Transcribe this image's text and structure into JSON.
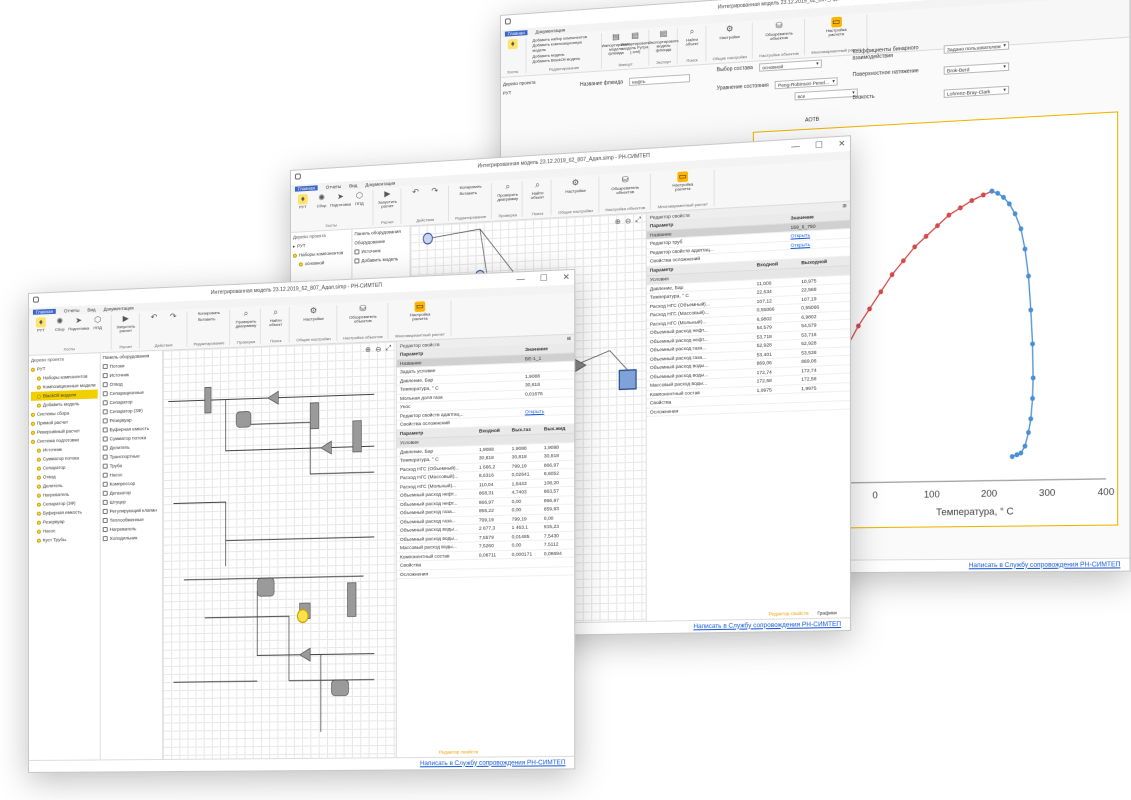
{
  "colors": {
    "accent": "#3a66c4",
    "selection": "#f2d000",
    "link": "#1a5bd6",
    "chart_border": "#f0b400",
    "bubble_curve": "#d34a4a",
    "dew_curve": "#4a8fd6"
  },
  "app": {
    "window_controls": [
      "—",
      "☐",
      "✕"
    ],
    "support_link": "Написать в Службу сопровождения РН-СИМТЕП"
  },
  "win3": {
    "title": "Интегрированная модель 23.12.2019_62_807_Адап.simp - РН-СИМТЕП",
    "tabs": [
      "Главная",
      "Документация"
    ],
    "ribbon": {
      "groups": [
        "Хосты",
        "Редактирование",
        "Импорт",
        "Экспорт",
        "Поиск",
        "Общие настройки",
        "Настройка объектов",
        "Многовариантный расчет"
      ],
      "buttons": [
        "Импортировать модель флюида",
        "Импортировать модель Рутра (.xml)",
        "Экспортировать модель флюида",
        "Найти объект",
        "Настройки",
        "Обозреватель объектов",
        "Настройка расчета"
      ],
      "checks": [
        "Добавить набор компонентов",
        "Добавить композиционную модель",
        "Добавить модель",
        "Добавить BlackOil модель"
      ]
    },
    "tree_header": "Дерево проекта",
    "tree_item": "РУТ",
    "form": {
      "fluid_name_label": "Название флюида",
      "fluid_name_value": "нефть",
      "composition_label": "Выбор состава",
      "composition_value": "основной",
      "eos_label": "Уравнение состояния",
      "eos_value": "Peng-Robinson Penel...",
      "all_label": "все",
      "binary_label": "Коэффициенты бинарного взаимодействия",
      "binary_value": "Задано пользователем",
      "tension_label": "Поверхностное натяжение",
      "tension_value": "Brok-Berd",
      "viscosity_label": "Вязкость",
      "viscosity_value": "Lohrenz-Bray-Clark",
      "tab_label": "АОТВ"
    }
  },
  "win2": {
    "title": "Интегрированная модель 23.12.2019_62_807_Адап.simp - РН-СИМТЕП",
    "tabs": [
      "Главная",
      "Отчеты",
      "Вид",
      "Документация"
    ],
    "ribbon": {
      "groups": [
        "Хосты",
        "Расчет",
        "Действия",
        "Редактирование",
        "Проверка",
        "Поиск",
        "Общие настройки",
        "Настройка объектов",
        "Многовариантный расчет"
      ],
      "buttons": [
        "РУТ",
        "Сбор",
        "Подготовка",
        "ППД",
        "Запустить расчет",
        "Копировать",
        "Вставить",
        "Проверить диаграмму",
        "Найти объект",
        "Настройки",
        "Обозреватель объектов",
        "Настройка расчета"
      ]
    },
    "tree_header": "Дерево проекта",
    "tree_items": [
      "РУТ",
      "Наборы компонентов",
      "основной"
    ],
    "palette_header": "Панель оборудования",
    "palette_items": [
      "Оборудование",
      "Источник",
      "Добавить модель"
    ],
    "props_header": "Редактор свойств",
    "props": {
      "col_param": "Параметр",
      "col_value": "Значение",
      "rows": [
        {
          "p": "Название",
          "v": "159_6_750"
        },
        {
          "p": "Редактор труб",
          "v": "Открыть"
        },
        {
          "p": "Редактор свойств адаптац...",
          "v": "Открыть"
        },
        {
          "p": "Свойства осложнений",
          "v": ""
        }
      ]
    },
    "flow": {
      "col_param": "Параметр",
      "col_in": "Входной",
      "col_out": "Выходной",
      "group": "Условия",
      "rows": [
        {
          "p": "Давление, Бар",
          "i": "11,000",
          "o": "10,975"
        },
        {
          "p": "Температура, ° С",
          "i": "22,634",
          "o": "22,568"
        },
        {
          "p": "Расход НГС (Объемный)...",
          "i": "107,12",
          "o": "107,19"
        },
        {
          "p": "Расход НГС (Массовый)...",
          "i": "0,55066",
          "o": "0,55066"
        },
        {
          "p": "Расход НГС (Мольный)...",
          "i": "6,9802",
          "o": "6,9802"
        },
        {
          "p": "Объемный расход нефт...",
          "i": "54,579",
          "o": "54,579"
        },
        {
          "p": "Объемный расход нефт...",
          "i": "53,718",
          "o": "53,716"
        },
        {
          "p": "Объемный расход газа...",
          "i": "52,928",
          "o": "52,928"
        },
        {
          "p": "Объемный расход газа...",
          "i": "53,401",
          "o": "53,538"
        },
        {
          "p": "Объемный расход воды...",
          "i": "869,06",
          "o": "869,06"
        },
        {
          "p": "Объемный расход воды...",
          "i": "172,74",
          "o": "172,74"
        },
        {
          "p": "Массовый расход воды...",
          "i": "172,58",
          "o": "172,58"
        },
        {
          "p": "Компонентный состав",
          "i": "1,9975",
          "o": "1,9975"
        },
        {
          "p": "Свойства",
          "i": "",
          "o": ""
        },
        {
          "p": "Осложнения",
          "i": "",
          "o": ""
        }
      ]
    },
    "bottom_tabs": [
      "Редактор свойств",
      "Графики"
    ]
  },
  "win1": {
    "title": "Интегрированная модель 23.12.2019_62_807_Адап.simp - РН-СИМТЕП",
    "tabs": [
      "Главная",
      "Отчеты",
      "Вид",
      "Документация"
    ],
    "ribbon": {
      "groups": [
        "Хосты",
        "Расчет",
        "Действия",
        "Редактирование",
        "Проверка",
        "Поиск",
        "Общие настройки",
        "Настройка объектов",
        "Многовариантный расчет"
      ],
      "buttons": [
        "РУТ",
        "Сбор",
        "Подготовка",
        "ППД",
        "Запустить расчет",
        "Копировать",
        "Вставить",
        "Проверить диаграмму",
        "Найти объект",
        "Настройки",
        "Обозреватель объектов",
        "Настройка расчета"
      ]
    },
    "tree_header": "Дерево проекта",
    "tree_items": [
      "РУТ",
      "Наборы компонентов",
      "Композиционные модели",
      "BlackOil модели",
      "Добавить модель",
      "Системы сбора",
      "Прямой расчет",
      "Реверсивный расчет",
      "Система подготовки",
      "Источник",
      "Сумматор потока",
      "Сепаратор",
      "Отвод",
      "Делитель",
      "Нагреватель",
      "Сепаратор (3Ф)",
      "Буферная емкость",
      "Резервуар",
      "Насос",
      "Куст Трубы"
    ],
    "palette_header": "Панель оборудования",
    "palette_items": [
      "Потоки",
      "Источник",
      "Отвод",
      "Сепарационные",
      "Сепаратор",
      "Сепаратор (3Ф)",
      "Резервуар",
      "Буферная емкость",
      "Сумматор потока",
      "Делитель",
      "Транспортные",
      "Труба",
      "Насос",
      "Компрессор",
      "Дегазатор",
      "Штуцер",
      "Регулирующий клапан",
      "Теплообменные",
      "Нагреватель",
      "Холодильник"
    ],
    "props_header": "Редактор свойств",
    "props": {
      "col_param": "Параметр",
      "col_value": "Значение",
      "rows": [
        {
          "p": "Название",
          "v": "БЕ-1_1"
        },
        {
          "p": "Задать условие",
          "v": ""
        },
        {
          "p": "Давление, Бар",
          "v": "1,9088"
        },
        {
          "p": "Температура, ° С",
          "v": "30,818"
        },
        {
          "p": "Мольная доля газа",
          "v": "0,01676"
        },
        {
          "p": "Унос",
          "v": ""
        },
        {
          "p": "Редактор свойств адаптац...",
          "v": "Открыть"
        },
        {
          "p": "Свойства осложнений",
          "v": ""
        }
      ]
    },
    "flow": {
      "col_param": "Параметр",
      "col_in": "Входной",
      "col_gas": "Вых.газ",
      "col_liq": "Вых.жид",
      "group": "Условия",
      "rows": [
        {
          "p": "Давление, Бар",
          "i": "1,9088",
          "g": "1,9088",
          "l": "1,9088"
        },
        {
          "p": "Температура, ° С",
          "i": "30,818",
          "g": "30,818",
          "l": "30,818"
        },
        {
          "p": "Расход НГС (Объемный)...",
          "i": "1 666,2",
          "g": "799,19",
          "l": "866,97"
        },
        {
          "p": "Расход НГС (Массовый)...",
          "i": "8,6316",
          "g": "0,02641",
          "l": "8,6052"
        },
        {
          "p": "Расход НГС (Мольный)...",
          "i": "110,04",
          "g": "1,8443",
          "l": "108,20"
        },
        {
          "p": "Объемный расход нефт...",
          "i": "868,31",
          "g": "4,7403",
          "l": "863,57"
        },
        {
          "p": "Объемный расход нефт...",
          "i": "866,97",
          "g": "0,00",
          "l": "866,97"
        },
        {
          "p": "Объемный расход газа...",
          "i": "856,22",
          "g": "0,00",
          "l": "859,93"
        },
        {
          "p": "Объемный расход газа...",
          "i": "799,19",
          "g": "799,19",
          "l": "0,00"
        },
        {
          "p": "Объемный расход воды...",
          "i": "2 877,3",
          "g": "1 463,1",
          "l": "915,23"
        },
        {
          "p": "Объемный расход воды...",
          "i": "7,5579",
          "g": "0,01485",
          "l": "7,5430"
        },
        {
          "p": "Массовый расход воды...",
          "i": "7,5260",
          "g": "0,00",
          "l": "7,5112"
        },
        {
          "p": "Компонентный состав",
          "i": "0,08711",
          "g": "0,000171",
          "l": "0,08694"
        },
        {
          "p": "Свойства",
          "i": "",
          "g": "",
          "l": ""
        },
        {
          "p": "Осложнения",
          "i": "",
          "g": "",
          "l": ""
        }
      ]
    },
    "bottom_tabs": [
      "Редактор свойств"
    ]
  },
  "chart_data": {
    "type": "line",
    "xlabel": "Температура, ° С",
    "x_ticks": [
      0,
      100,
      200,
      300,
      400
    ],
    "xlim": [
      -200,
      400
    ],
    "ylim": [
      0,
      100
    ],
    "grid": false,
    "series": [
      {
        "x": [
          -190,
          -170,
          -150,
          -130,
          -110,
          -90,
          -70,
          -50,
          -30,
          -10,
          10,
          30,
          50,
          70,
          90,
          110,
          130,
          150,
          170,
          190,
          205
        ],
        "values": [
          2,
          6,
          11,
          17,
          23,
          29,
          35,
          41,
          47,
          52,
          57,
          62,
          66,
          70,
          73,
          76,
          79,
          81,
          83,
          84.5,
          85.5
        ]
      },
      {
        "x": [
          205,
          215,
          225,
          235,
          245,
          255,
          262,
          268,
          272,
          275,
          276,
          275,
          272,
          268,
          262,
          255,
          248,
          240
        ],
        "values": [
          85.5,
          84.8,
          83.5,
          81.5,
          78.5,
          74,
          68,
          60,
          50,
          40,
          30,
          24,
          18,
          14,
          10,
          8,
          7.5,
          7
        ]
      }
    ]
  }
}
